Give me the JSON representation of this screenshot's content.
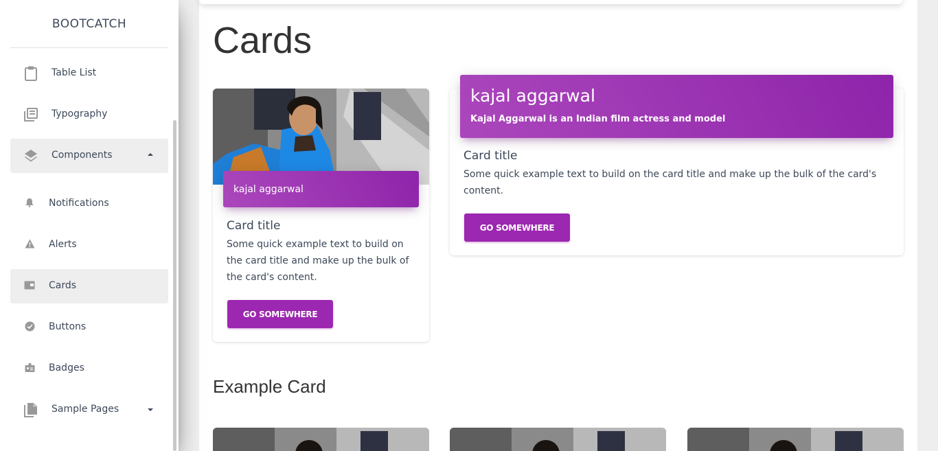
{
  "sidebar": {
    "brand": "BOOTCATCH",
    "items": [
      {
        "label": "Table List",
        "icon": "clipboard-icon"
      },
      {
        "label": "Typography",
        "icon": "library-books-icon"
      },
      {
        "label": "Components",
        "icon": "layers-icon"
      },
      {
        "label": "Notifications",
        "icon": "bell-icon"
      },
      {
        "label": "Alerts",
        "icon": "warning-icon"
      },
      {
        "label": "Cards",
        "icon": "card-icon"
      },
      {
        "label": "Buttons",
        "icon": "check-circle-icon"
      },
      {
        "label": "Badges",
        "icon": "badge-icon"
      },
      {
        "label": "Sample Pages",
        "icon": "file-copy-icon"
      }
    ]
  },
  "main": {
    "title": "Cards",
    "card1": {
      "badge": "kajal aggarwal",
      "title": "Card title",
      "text": "Some quick example text to build on the card title and make up the bulk of the card's content.",
      "button": "GO SOMEWHERE"
    },
    "card2": {
      "header_title": "kajal aggarwal",
      "header_subtitle": "Kajal Aggarwal is an Indian film actress and model",
      "title": "Card title",
      "text": "Some quick example text to build on the card title and make up the bulk of the card's content.",
      "button": "GO SOMEWHERE"
    },
    "section_title": "Example Card"
  },
  "colors": {
    "accent": "#9c27b0",
    "gradient_start": "#ab47bc",
    "gradient_end": "#8e24aa"
  }
}
